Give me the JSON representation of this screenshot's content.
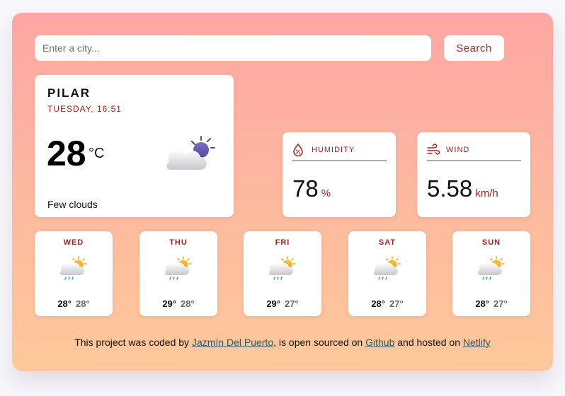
{
  "search": {
    "placeholder": "Enter a city...",
    "value": "",
    "button_label": "Search"
  },
  "current": {
    "city": "PILAR",
    "datetime": "TUESDAY, 16:51",
    "temperature": "28",
    "unit": "°C",
    "description": "Few clouds",
    "icon": "few-clouds-night-icon"
  },
  "humidity": {
    "label": "HUMIDITY",
    "value": "78",
    "unit": "%",
    "icon": "humidity-drop-icon"
  },
  "wind": {
    "label": "WIND",
    "value": "5.58",
    "unit": "km/h",
    "icon": "wind-icon"
  },
  "forecast": [
    {
      "day": "WED",
      "max": "28°",
      "min": "28°",
      "icon": "rain-sun-cloud-icon"
    },
    {
      "day": "THU",
      "max": "29°",
      "min": "28°",
      "icon": "rain-sun-cloud-icon"
    },
    {
      "day": "FRI",
      "max": "29°",
      "min": "27°",
      "icon": "rain-sun-cloud-icon"
    },
    {
      "day": "SAT",
      "max": "28°",
      "min": "27°",
      "icon": "rain-sun-cloud-icon"
    },
    {
      "day": "SUN",
      "max": "28°",
      "min": "27°",
      "icon": "rain-sun-cloud-icon"
    }
  ],
  "footer": {
    "t1": "This project was coded by ",
    "author": "Jazmín Del Puerto",
    "t2": ", is open sourced on ",
    "github": "Github",
    "t3": " and hosted on ",
    "netlify": "Netlify"
  },
  "colors": {
    "accent": "#a3211b",
    "gradient_top": "#fea6a3",
    "gradient_bottom": "#fec89a",
    "link": "#2d5a66"
  }
}
